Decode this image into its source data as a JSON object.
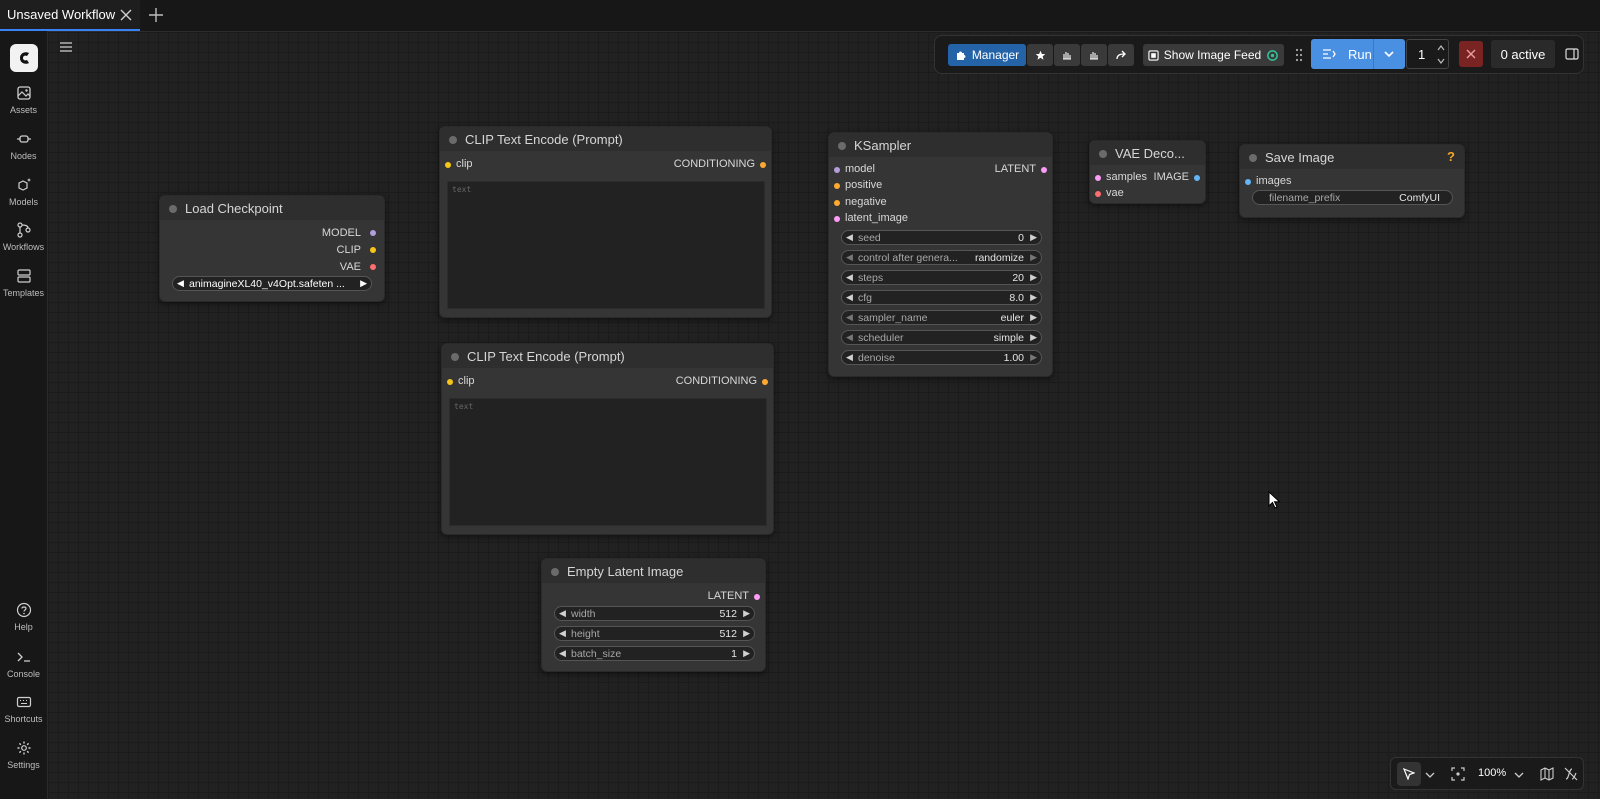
{
  "tabs": [
    {
      "label": "Unsaved Workflow"
    }
  ],
  "sidebar": {
    "top_items": [
      {
        "label": "Assets",
        "icon": "image-icon"
      },
      {
        "label": "Nodes",
        "icon": "node-icon"
      },
      {
        "label": "Models",
        "icon": "cube-sparkle-icon"
      },
      {
        "label": "Workflows",
        "icon": "workflow-icon"
      },
      {
        "label": "Templates",
        "icon": "template-icon"
      }
    ],
    "bottom_items": [
      {
        "label": "Help",
        "icon": "help-icon"
      },
      {
        "label": "Console",
        "icon": "terminal-icon"
      },
      {
        "label": "Shortcuts",
        "icon": "keyboard-icon"
      },
      {
        "label": "Settings",
        "icon": "gear-icon"
      }
    ]
  },
  "toolbar": {
    "manager_label": "Manager",
    "show_feed_label": "Show Image Feed",
    "run_label": "Run",
    "batch_count": "1",
    "active_label": "0 active"
  },
  "nodes": {
    "load_checkpoint": {
      "title": "Load Checkpoint",
      "outputs": [
        "MODEL",
        "CLIP",
        "VAE"
      ],
      "ckpt_name": "animagineXL40_v4Opt.safeten ..."
    },
    "clip_pos": {
      "title": "CLIP Text Encode (Prompt)",
      "input": "clip",
      "output": "CONDITIONING",
      "placeholder": "text"
    },
    "clip_neg": {
      "title": "CLIP Text Encode (Prompt)",
      "input": "clip",
      "output": "CONDITIONING",
      "placeholder": "text"
    },
    "empty_latent": {
      "title": "Empty Latent Image",
      "output": "LATENT",
      "widgets": [
        {
          "label": "width",
          "value": "512"
        },
        {
          "label": "height",
          "value": "512"
        },
        {
          "label": "batch_size",
          "value": "1"
        }
      ]
    },
    "ksampler": {
      "title": "KSampler",
      "inputs": [
        "model",
        "positive",
        "negative",
        "latent_image"
      ],
      "output": "LATENT",
      "widgets": [
        {
          "label": "seed",
          "value": "0"
        },
        {
          "label": "control after genera...",
          "value": "randomize"
        },
        {
          "label": "steps",
          "value": "20"
        },
        {
          "label": "cfg",
          "value": "8.0"
        },
        {
          "label": "sampler_name",
          "value": "euler"
        },
        {
          "label": "scheduler",
          "value": "simple"
        },
        {
          "label": "denoise",
          "value": "1.00"
        }
      ]
    },
    "vae_decode": {
      "title": "VAE Deco...",
      "inputs": [
        "samples",
        "vae"
      ],
      "output": "IMAGE"
    },
    "save_image": {
      "title": "Save Image",
      "input": "images",
      "help": "?",
      "prefix_label": "filename_prefix",
      "prefix_value": "ComfyUI"
    }
  },
  "canvas_controls": {
    "zoom": "100%"
  },
  "colors": {
    "accent": "#4a90e2",
    "manager": "#2563a8",
    "stop": "#7a2323",
    "clip_slot": "#f5c518",
    "conditioning_slot": "#ffa931",
    "model_slot": "#b39ddb",
    "latent_slot": "#ff9cf9",
    "vae_slot": "#ff6e6e",
    "image_slot": "#64b5f6"
  }
}
